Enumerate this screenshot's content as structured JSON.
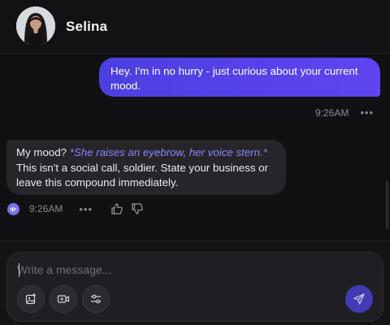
{
  "header": {
    "name": "Selina"
  },
  "messages": {
    "user": {
      "text": "Hey. I'm in no hurry - just curious about your current mood.",
      "time": "9:26AM",
      "more": "•••"
    },
    "ai": {
      "text_lead": "My mood? ",
      "action": "*She raises an eyebrow, her voice stern.*",
      "text_rest": "This isn't a social call, soldier. State your business or leave this compound immediately.",
      "time": "9:26AM",
      "more": "•••"
    }
  },
  "composer": {
    "placeholder": "Write a message...",
    "tools": [
      "add-image-icon",
      "video-icon",
      "settings-sliders-icon"
    ],
    "send_icon": "send-icon"
  },
  "colors": {
    "accent": "#5a45ee",
    "action_text": "#8d84ff"
  }
}
